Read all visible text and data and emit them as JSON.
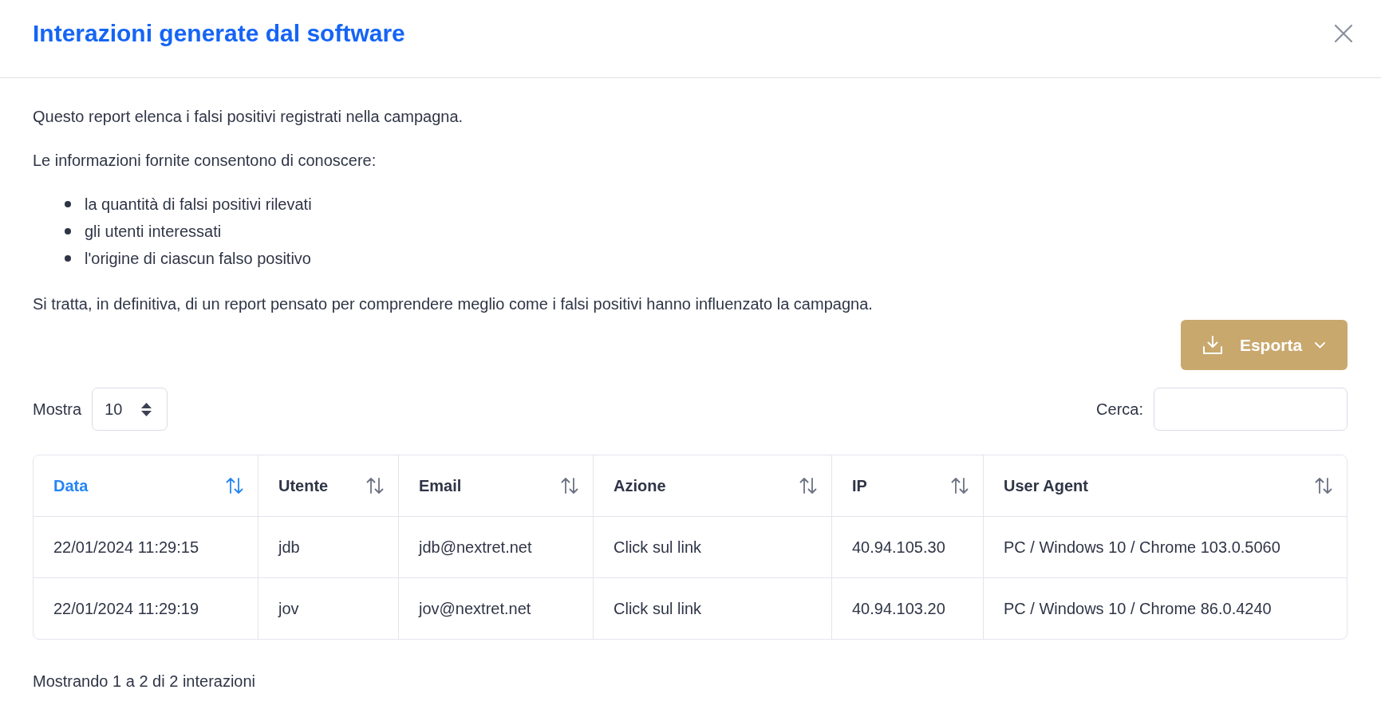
{
  "dialog": {
    "title": "Interazioni generate dal software"
  },
  "description": {
    "intro": "Questo report elenca i falsi positivi registrati nella campagna.",
    "lead": "Le informazioni fornite consentono di conoscere:",
    "bullets": [
      "la quantità di falsi positivi rilevati",
      "gli utenti interessati",
      "l'origine di ciascun falso positivo"
    ],
    "summary": "Si tratta, in definitiva, di un report pensato per comprendere meglio come i falsi positivi hanno influenzato la campagna."
  },
  "export_button": {
    "label": "Esporta"
  },
  "length_control": {
    "label": "Mostra",
    "value": "10"
  },
  "search": {
    "label": "Cerca:"
  },
  "table": {
    "columns": [
      {
        "label": "Data",
        "sorted": true
      },
      {
        "label": "Utente",
        "sorted": false
      },
      {
        "label": "Email",
        "sorted": false
      },
      {
        "label": "Azione",
        "sorted": false
      },
      {
        "label": "IP",
        "sorted": false
      },
      {
        "label": "User Agent",
        "sorted": false
      }
    ],
    "rows": [
      [
        "22/01/2024 11:29:15",
        "jdb",
        "jdb@nextret.net",
        "Click sul link",
        "40.94.105.30",
        "PC / Windows 10 / Chrome 103.0.5060"
      ],
      [
        "22/01/2024 11:29:19",
        "jov",
        "jov@nextret.net",
        "Click sul link",
        "40.94.103.20",
        "PC / Windows 10 / Chrome 86.0.4240"
      ]
    ]
  },
  "footer": {
    "info": "Mostrando 1 a 2 di 2 interazioni"
  }
}
